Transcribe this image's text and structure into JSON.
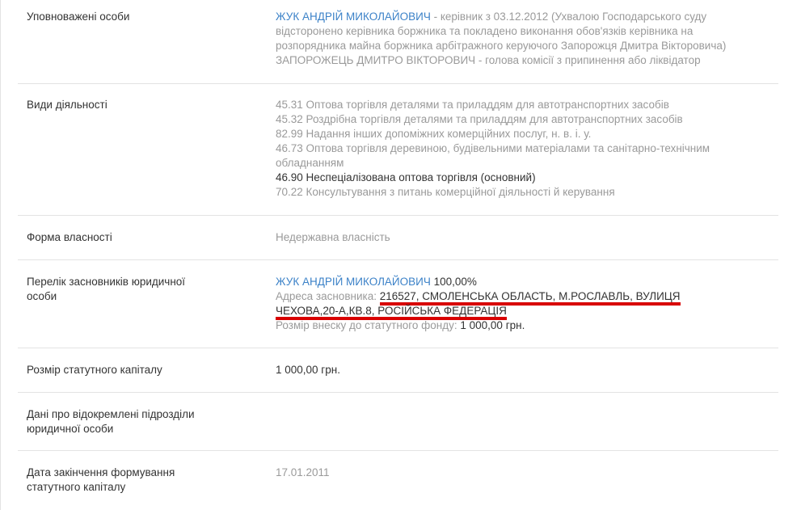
{
  "rows": {
    "authorized": {
      "label": "Уповноважені особи",
      "person1_name": "ЖУК АНДРІЙ МИКОЛАЙОВИЧ",
      "person1_role_l1": " - керівник з 03.12.2012 (Ухвалою Господарського суду",
      "person1_role_l2": "відсторонено керівника боржника та покладено виконання обов'язків керівника на",
      "person1_role_l3": "розпорядника майна боржника арбітражного керуючого Запорожця Дмитра Вікторовича)",
      "person2": "ЗАПОРОЖЕЦЬ ДМИТРО ВІКТОРОВИЧ - голова комісії з припинення або ліквідатор"
    },
    "activities": {
      "label": "Види діяльності",
      "items": [
        "45.31 Оптова торгівля деталями та приладдям для автотранспортних засобів",
        "45.32 Роздрібна торгівля деталями та приладдям для автотранспортних засобів",
        "82.99 Надання інших допоміжних комерційних послуг, н. в. і. у.",
        "46.73 Оптова торгівля деревиною, будівельними матеріалами та санітарно-технічним",
        "обладнанням",
        "46.90 Неспеціалізована оптова торгівля (основний)",
        "70.22 Консультування з питань комерційної діяльності й керування"
      ]
    },
    "ownership": {
      "label": "Форма власності",
      "value": "Недержавна власність"
    },
    "founders": {
      "label_l1": "Перелік засновників юридичної",
      "label_l2": "особи",
      "name": "ЖУК АНДРІЙ МИКОЛАЙОВИЧ",
      "share": " 100,00%",
      "address_label": "Адреса засновника: ",
      "address_l1": "216527, СМОЛЕНСЬКА ОБЛАСТЬ, М.РОСЛАВЛЬ, ВУЛИЦЯ",
      "address_l2": "ЧЕХОВА,20-А,КВ.8, РОСІЙСЬКА ФЕДЕРАЦІЯ",
      "contribution_label": "Розмір внеску до статутного фонду: ",
      "contribution_value": "1 000,00 грн."
    },
    "capital": {
      "label": "Розмір статутного капіталу",
      "value": "1 000,00 грн."
    },
    "branches": {
      "label_l1": "Дані про відокремлені підрозділи",
      "label_l2": "юридичної особи"
    },
    "capital_date": {
      "label_l1": "Дата закінчення формування",
      "label_l2": "статутного капіталу",
      "value": "17.01.2011"
    }
  },
  "colors": {
    "link": "#3c82c8",
    "muted": "#9a9a9a",
    "text": "#333333",
    "annotation_red": "#d80000"
  }
}
